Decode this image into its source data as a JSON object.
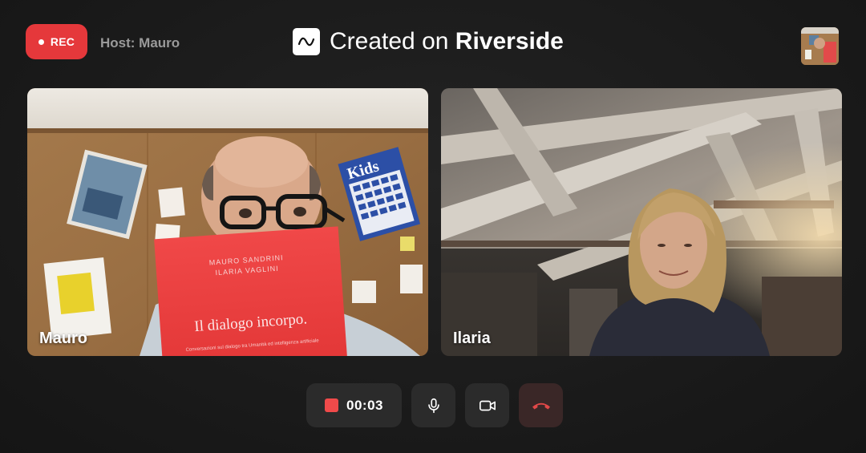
{
  "header": {
    "rec_label": "REC",
    "host_label": "Host: Mauro",
    "brand_prefix": "Created on ",
    "brand_name": "Riverside"
  },
  "participants": [
    {
      "name": "Mauro",
      "book": {
        "authors_line1": "MAURO SANDRINI",
        "authors_line2": "ILARIA VAGLINI",
        "title": "Il dialogo incorpo.",
        "subtitle": "Conversazioni sul dialogo tra Umanità ed intelligenza artificiale"
      },
      "poster_text": "Kids"
    },
    {
      "name": "Ilaria"
    }
  ],
  "controls": {
    "timer": "00:03",
    "stop_icon": "stop-square-icon",
    "mic_icon": "microphone-icon",
    "camera_icon": "video-camera-icon",
    "end_icon": "hang-up-phone-icon"
  },
  "colors": {
    "rec_red": "#e5383b",
    "stop_red": "#f04a4a",
    "end_call_red": "#e04848",
    "background": "#1a1a1a",
    "control_bg": "#2b2b2b"
  }
}
